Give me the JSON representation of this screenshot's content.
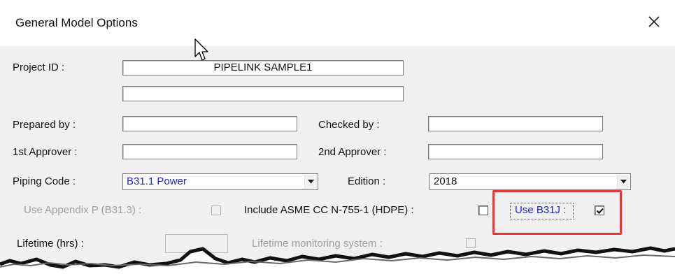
{
  "window": {
    "title": "General Model Options",
    "close_glyph": "✕"
  },
  "project_id": {
    "label": "Project ID  :",
    "value": "PIPELINK SAMPLE1",
    "line2_value": ""
  },
  "prepared_by": {
    "label": "Prepared by :",
    "value": ""
  },
  "checked_by": {
    "label": "Checked by  :",
    "value": ""
  },
  "approver1": {
    "label": "1st Approver :",
    "value": ""
  },
  "approver2": {
    "label": "2nd Approver :",
    "value": ""
  },
  "piping_code": {
    "label": "Piping Code  :",
    "value": "B31.1 Power"
  },
  "edition": {
    "label": "Edition :",
    "value": "2018"
  },
  "use_appendix_p": {
    "label": "Use Appendix P (B31.3) :",
    "checked": false,
    "enabled": false
  },
  "include_asme": {
    "label": "Include ASME CC N-755-1 (HDPE) :",
    "checked": false
  },
  "use_b31j": {
    "label": "Use B31J :",
    "checked": true
  },
  "lifetime": {
    "label": "Lifetime (hrs) :",
    "value": ""
  },
  "lifetime_monitoring": {
    "label": "Lifetime monitoring system :",
    "checked": false,
    "enabled": false
  },
  "colors": {
    "highlight": "#e23a3a",
    "accent_text": "#1a28c8",
    "dialog_bg": "#f0f0f0"
  },
  "icons": {
    "close": "close-icon",
    "cursor": "mouse-cursor-icon",
    "dropdown": "chevron-down-icon",
    "check": "checkmark-icon"
  }
}
